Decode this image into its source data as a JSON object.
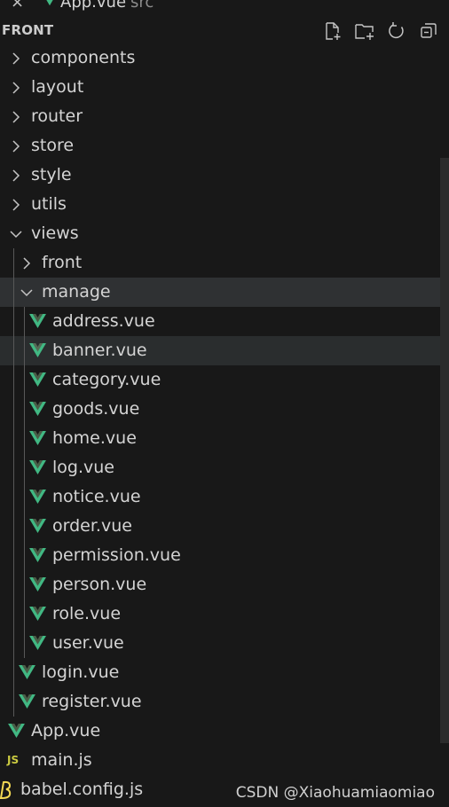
{
  "tab": {
    "close_glyph": "×",
    "file": "App.vue",
    "dir": "src"
  },
  "explorer": {
    "title": "FRONT",
    "actions": [
      "new-file",
      "new-folder",
      "refresh",
      "collapse-all"
    ]
  },
  "tree": {
    "components": "components",
    "layout": "layout",
    "router": "router",
    "store": "store",
    "style": "style",
    "utils": "utils",
    "views": "views",
    "front": "front",
    "manage": "manage",
    "manage_files": [
      "address.vue",
      "banner.vue",
      "category.vue",
      "goods.vue",
      "home.vue",
      "log.vue",
      "notice.vue",
      "order.vue",
      "permission.vue",
      "person.vue",
      "role.vue",
      "user.vue"
    ],
    "login": "login.vue",
    "register": "register.vue",
    "app": "App.vue",
    "main": "main.js",
    "main_icon_text": "JS",
    "babel": "babel.config.js"
  },
  "colors": {
    "vue_green": "#41b883",
    "js_yellow": "#cbcb41",
    "babel_yellow": "#f5da55"
  },
  "watermark": "CSDN @Xiaohuamiaomiao"
}
